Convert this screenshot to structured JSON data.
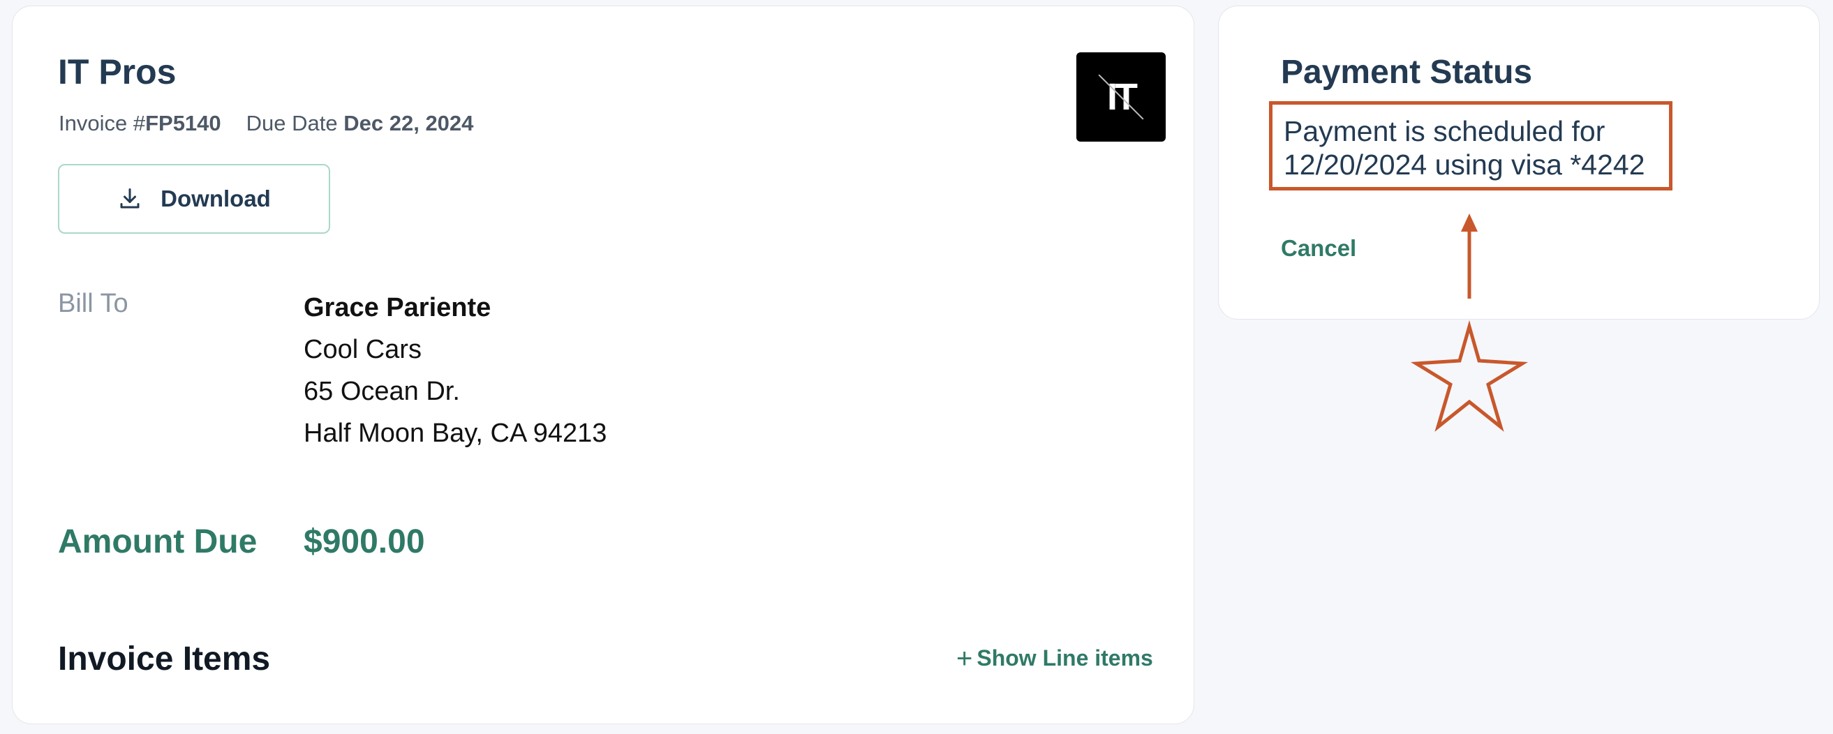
{
  "invoice": {
    "company_name": "IT Pros",
    "invoice_label": "Invoice #",
    "invoice_number": "FP5140",
    "due_label": "Due Date",
    "due_date": "Dec 22, 2024",
    "logo_text": "IT",
    "download_label": "Download",
    "bill_to_label": "Bill To",
    "bill_to": {
      "name": "Grace Pariente",
      "company": "Cool Cars",
      "street": "65 Ocean Dr.",
      "city": "Half Moon Bay, CA 94213"
    },
    "amount_due_label": "Amount Due",
    "amount_due": "$900.00",
    "items_title": "Invoice Items",
    "show_items_label": "Show Line items"
  },
  "payment_status": {
    "title": "Payment Status",
    "line1": "Payment is scheduled for",
    "date": "12/20/2024",
    "using": "using",
    "card": "visa *4242",
    "cancel_label": "Cancel"
  },
  "colors": {
    "accent_green": "#2f7a66",
    "annotation_orange": "#c8582b",
    "heading": "#233a52"
  },
  "icons": {
    "download": "download-icon",
    "plus": "plus-icon",
    "star_annotation": "star-icon",
    "arrow_annotation": "arrow-up-icon"
  }
}
